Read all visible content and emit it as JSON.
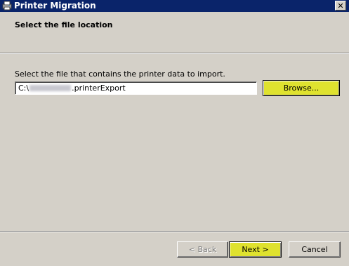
{
  "window": {
    "title": "Printer Migration",
    "close_glyph": "✕",
    "app_icon": "printer-migration-icon"
  },
  "header": {
    "title": "Select the file location"
  },
  "body": {
    "prompt": "Select the file that contains the printer data to import.",
    "path_prefix": "C:\\",
    "path_suffix": ".printerExport",
    "browse_label": "Browse..."
  },
  "footer": {
    "back_label": "< Back",
    "next_label": "Next >",
    "cancel_label": "Cancel"
  },
  "colors": {
    "titlebar": "#0a246a",
    "face": "#d4d0c8",
    "highlight_button": "#dfe22f"
  }
}
